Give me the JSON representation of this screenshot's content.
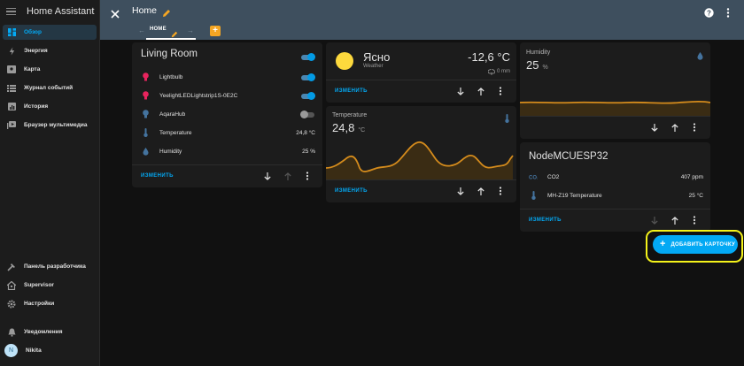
{
  "sidebar": {
    "title": "Home Assistant",
    "items": [
      {
        "label": "Обзор",
        "icon": "dashboard-icon",
        "active": true
      },
      {
        "label": "Энергия",
        "icon": "lightning-icon"
      },
      {
        "label": "Карта",
        "icon": "map-icon"
      },
      {
        "label": "Журнал событий",
        "icon": "list-icon"
      },
      {
        "label": "История",
        "icon": "chart-icon"
      },
      {
        "label": "Браузер мультимедиа",
        "icon": "media-icon"
      }
    ],
    "bottom_items": [
      {
        "label": "Панель разработчика",
        "icon": "hammer-icon"
      },
      {
        "label": "Supervisor",
        "icon": "home-assistant-icon"
      },
      {
        "label": "Настройки",
        "icon": "gear-icon"
      }
    ],
    "notifications": {
      "label": "Уведомления",
      "icon": "bell-icon"
    },
    "user": {
      "initial": "N",
      "name": "Nikita"
    }
  },
  "header": {
    "title": "Home",
    "tab": "HOME"
  },
  "cards": {
    "living_room": {
      "title": "Living Room",
      "entities": [
        {
          "name": "Lightbulb",
          "icon": "bulb-icon",
          "color": "#e8245e",
          "type": "toggle",
          "on": true
        },
        {
          "name": "YeelightLEDLightstrip1S-0E2C",
          "icon": "bulb-icon",
          "color": "#e8245e",
          "type": "toggle",
          "on": true
        },
        {
          "name": "AqaraHub",
          "icon": "bulb-icon",
          "color": "#44739e",
          "type": "toggle",
          "on": false
        },
        {
          "name": "Temperature",
          "icon": "thermometer-icon",
          "color": "#44739e",
          "type": "value",
          "value": "24,8 °C"
        },
        {
          "name": "Humidity",
          "icon": "water-drop-icon",
          "color": "#44739e",
          "type": "value",
          "value": "25 %"
        }
      ],
      "edit_label": "ИЗМЕНИТЬ"
    },
    "weather": {
      "condition": "Ясно",
      "sub": "Weather",
      "temperature": "-12,6 °C",
      "precipitation": "0 mm",
      "edit_label": "ИЗМЕНИТЬ"
    },
    "temperature": {
      "name": "Temperature",
      "value": "24,8",
      "unit": "°C",
      "edit_label": "ИЗМЕНИТЬ"
    },
    "humidity": {
      "name": "Humidity",
      "value": "25",
      "unit": "%"
    },
    "node": {
      "title": "NodeMCUESP32",
      "entities": [
        {
          "name": "CO2",
          "icon": "co2-icon",
          "value": "407 ppm"
        },
        {
          "name": "MH-Z19 Temperature",
          "icon": "thermometer-icon",
          "value": "25 °C"
        }
      ],
      "edit_label": "ИЗМЕНИТЬ"
    }
  },
  "add_card": {
    "label": "ДОБАВИТЬ КАРТОЧКУ"
  },
  "colors": {
    "accent": "#03a9f4",
    "header": "#3e4f5e",
    "graph": "#d48b1c",
    "highlight": "#f5f31a"
  }
}
